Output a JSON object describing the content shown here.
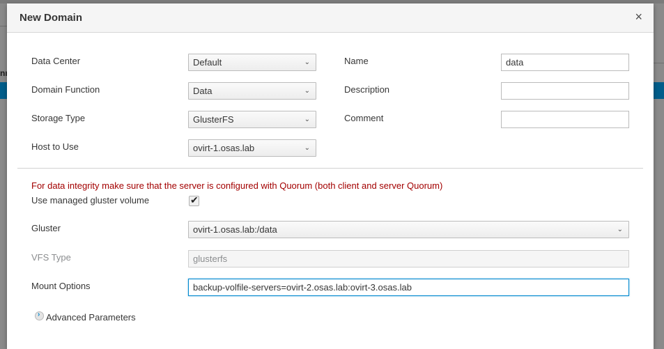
{
  "backdrop": {
    "left_text": "nn"
  },
  "dialog": {
    "title": "New Domain",
    "close_symbol": "×"
  },
  "form": {
    "data_center": {
      "label": "Data Center",
      "value": "Default"
    },
    "domain_function": {
      "label": "Domain Function",
      "value": "Data"
    },
    "storage_type": {
      "label": "Storage Type",
      "value": "GlusterFS"
    },
    "host_to_use": {
      "label": "Host to Use",
      "value": "ovirt-1.osas.lab"
    },
    "name": {
      "label": "Name",
      "value": "data"
    },
    "description": {
      "label": "Description",
      "value": ""
    },
    "comment": {
      "label": "Comment",
      "value": ""
    }
  },
  "gluster_section": {
    "warning": "For data integrity make sure that the server is configured with Quorum (both client and server Quorum)",
    "use_managed": {
      "label": "Use managed gluster volume",
      "checked": true
    },
    "gluster": {
      "label": "Gluster",
      "value": "ovirt-1.osas.lab:/data"
    },
    "vfs_type": {
      "label": "VFS Type",
      "value": "glusterfs"
    },
    "mount_options": {
      "label": "Mount Options",
      "value": "backup-volfile-servers=ovirt-2.osas.lab:ovirt-3.osas.lab"
    },
    "advanced": {
      "label": "Advanced Parameters",
      "icon": "chevron-right-circle-icon"
    }
  },
  "colors": {
    "warning": "#a30000",
    "focus": "#0088ce",
    "backdrop_blue": "#005d8a"
  }
}
